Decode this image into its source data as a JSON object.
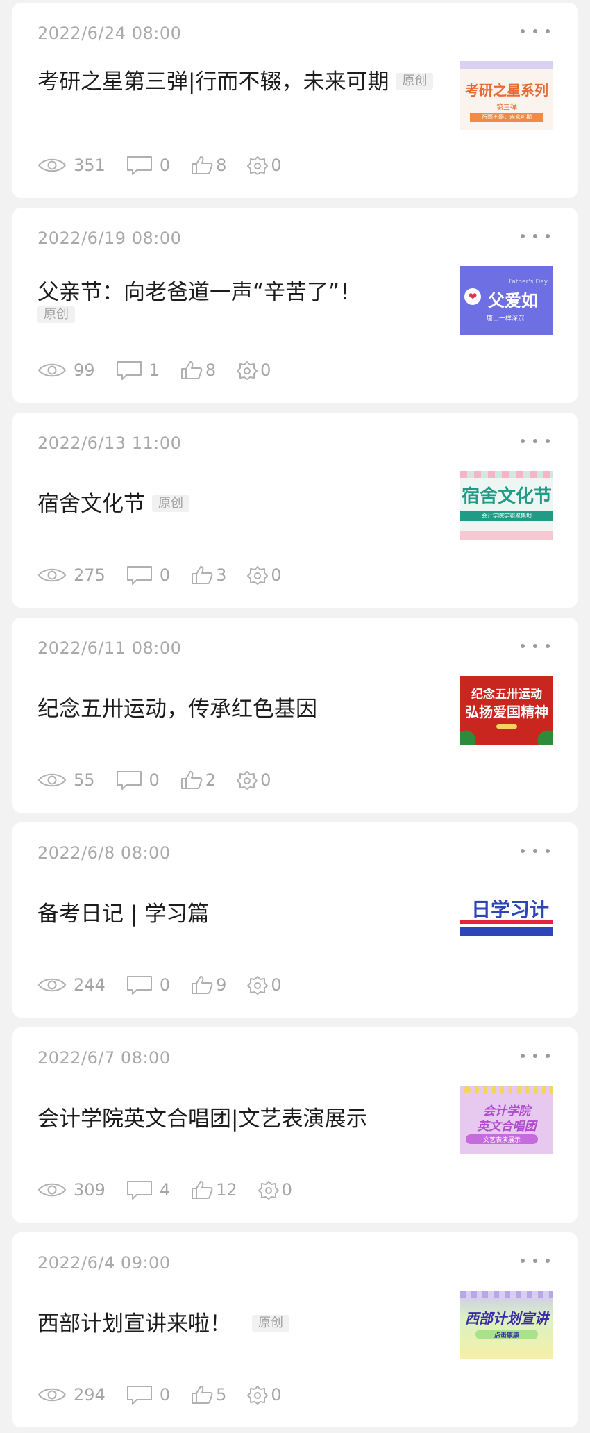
{
  "posts": [
    {
      "date": "2022/6/24 08:00",
      "title": "考研之星第三弹|行而不辍，未来可期",
      "badge": "原创",
      "views": "351",
      "comments": "0",
      "likes": "8",
      "shares": "0",
      "thumb": {
        "name": "thumb-kaoyan-star",
        "text": "考研之星系列",
        "sub1": "第三弹",
        "sub2": "行而不辍，未来可期",
        "colors": {
          "bg": "#fbf3ee",
          "accent": "#e76a34"
        }
      }
    },
    {
      "date": "2022/6/19 08:00",
      "title": "父亲节：向老爸道一声“辛苦了”！",
      "badge": "原创",
      "views": "99",
      "comments": "1",
      "likes": "8",
      "shares": "0",
      "thumb": {
        "name": "thumb-fathers-day",
        "text": "父爱如",
        "sub1": "Father's Day",
        "sub2": "唐山一样深沉",
        "colors": {
          "bg": "#6e6fe3",
          "accent": "#ffffff"
        }
      }
    },
    {
      "date": "2022/6/13 11:00",
      "title": "宿舍文化节",
      "badge": "原创",
      "views": "275",
      "comments": "0",
      "likes": "3",
      "shares": "0",
      "thumb": {
        "name": "thumb-dorm-culture",
        "text": "宿舍文化节",
        "sub1": "会计学院学霸聚集地",
        "sub2": "",
        "colors": {
          "bg": "#eef6f3",
          "accent": "#1f9b86"
        }
      }
    },
    {
      "date": "2022/6/11 08:00",
      "title": "纪念五卅运动，传承红色基因",
      "badge": "",
      "views": "55",
      "comments": "0",
      "likes": "2",
      "shares": "0",
      "thumb": {
        "name": "thumb-may30",
        "text": "纪念五卅运动",
        "sub1": "弘扬爱国精神",
        "sub2": "",
        "colors": {
          "bg": "#c8261f",
          "accent": "#ffffff"
        }
      }
    },
    {
      "date": "2022/6/8 08:00",
      "title": "备考日记 | 学习篇",
      "badge": "",
      "views": "244",
      "comments": "0",
      "likes": "9",
      "shares": "0",
      "thumb": {
        "name": "thumb-study-plan",
        "text": "日学习计",
        "sub1": "",
        "sub2": "",
        "colors": {
          "bg": "#ffffff",
          "accent": "#2c46b8"
        }
      }
    },
    {
      "date": "2022/6/7 08:00",
      "title": "会计学院英文合唱团|文艺表演展示",
      "badge": "",
      "views": "309",
      "comments": "4",
      "likes": "12",
      "shares": "0",
      "thumb": {
        "name": "thumb-choir",
        "text": "会计学院",
        "sub1": "英文合唱团",
        "sub2": "文艺表演展示",
        "colors": {
          "bg": "#e7c9ef",
          "accent": "#b04bd0"
        }
      }
    },
    {
      "date": "2022/6/4 09:00",
      "title": "西部计划宣讲来啦！",
      "badge": "原创",
      "views": "294",
      "comments": "0",
      "likes": "5",
      "shares": "0",
      "thumb": {
        "name": "thumb-west-plan",
        "text": "西部计划宣讲",
        "sub1": "点击康康",
        "sub2": "",
        "colors": {
          "bg": "#d9f2c2",
          "accent": "#3a2aa8"
        }
      }
    }
  ]
}
